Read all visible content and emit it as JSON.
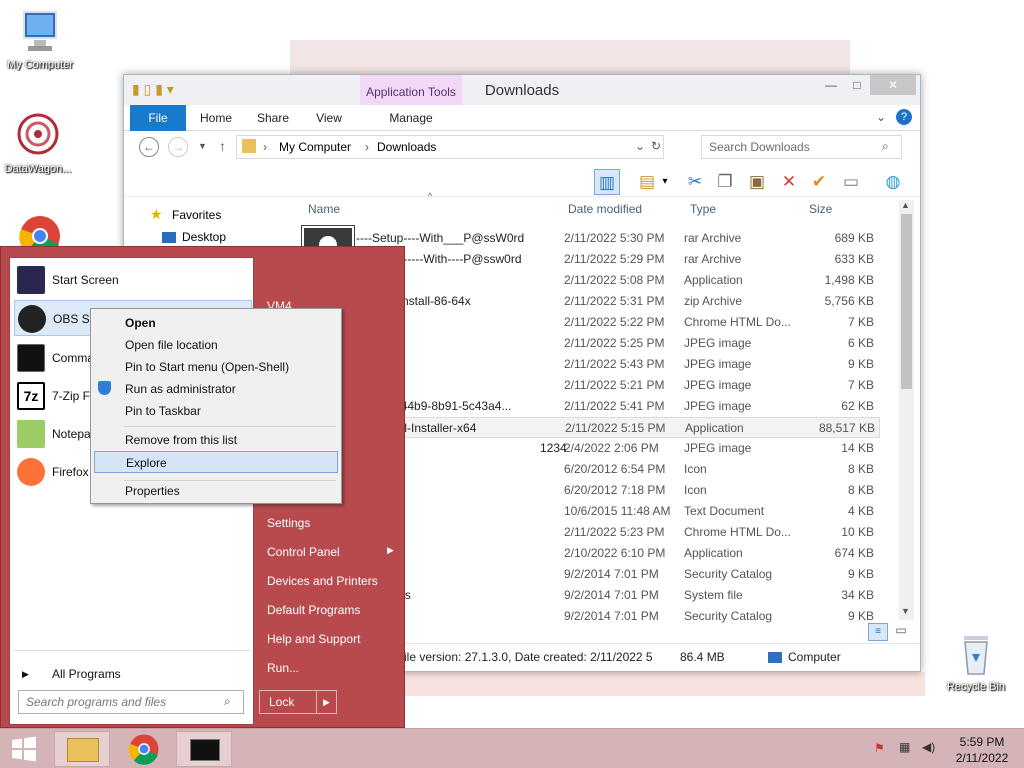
{
  "desktop": {
    "icons": [
      "My Computer",
      "DataWagon...",
      "Recycle Bin"
    ]
  },
  "explorer": {
    "title": "Downloads",
    "application_tools": "Application Tools",
    "ribbon_tabs": [
      "File",
      "Home",
      "Share",
      "View",
      "Manage"
    ],
    "address": {
      "path1": "My Computer",
      "path2": "Downloads"
    },
    "search_placeholder": "Search Downloads",
    "nav": {
      "favorites": "Favorites",
      "desktop": "Desktop"
    },
    "columns": {
      "name": "Name",
      "date": "Date modified",
      "type": "Type",
      "size": "Size"
    },
    "files": [
      {
        "name": "----Setup----With___P@ssW0rd",
        "date": "2/11/2022 5:30 PM",
        "type": "rar Archive",
        "size": "689 KB"
      },
      {
        "name": "----Setup-----With----P@ssw0rd",
        "date": "2/11/2022 5:29 PM",
        "type": "rar Archive",
        "size": "633 KB"
      },
      {
        "name": "",
        "date": "2/11/2022 5:08 PM",
        "type": "Application",
        "size": "1,498 KB"
      },
      {
        "name": "57-MSI-Install-86-64x",
        "date": "2/11/2022 5:31 PM",
        "type": "zip Archive",
        "size": "5,756 KB"
      },
      {
        "name": "",
        "date": "2/11/2022 5:22 PM",
        "type": "Chrome HTML Do...",
        "size": "7 KB"
      },
      {
        "name": "",
        "date": "2/11/2022 5:25 PM",
        "type": "JPEG image",
        "size": "6 KB"
      },
      {
        "name": "",
        "date": "2/11/2022 5:43 PM",
        "type": "JPEG image",
        "size": "9 KB"
      },
      {
        "name": "",
        "date": "2/11/2022 5:21 PM",
        "type": "JPEG image",
        "size": "7 KB"
      },
      {
        "name": "6f-088e-44b9-8b91-5c43a4...",
        "date": "2/11/2022 5:41 PM",
        "type": "JPEG image",
        "size": "62 KB"
      },
      {
        "name": "7.1.3-Full-Installer-x64",
        "date": "2/11/2022 5:15 PM",
        "type": "Application",
        "size": "88,517 KB"
      },
      {
        "name": "1234",
        "date": "2/4/2022 2:06 PM",
        "type": "JPEG image",
        "size": "14 KB"
      },
      {
        "name": "",
        "date": "6/20/2012 6:54 PM",
        "type": "Icon",
        "size": "8 KB"
      },
      {
        "name": "",
        "date": "6/20/2012 7:18 PM",
        "type": "Icon",
        "size": "8 KB"
      },
      {
        "name": "",
        "date": "10/6/2015 11:48 AM",
        "type": "Text Document",
        "size": "4 KB"
      },
      {
        "name": "",
        "date": "2/11/2022 5:23 PM",
        "type": "Chrome HTML Do...",
        "size": "10 KB"
      },
      {
        "name": "",
        "date": "2/10/2022 6:10 PM",
        "type": "Application",
        "size": "674 KB"
      },
      {
        "name": "_2003",
        "date": "9/2/2014 7:01 PM",
        "type": "Security Catalog",
        "size": "9 KB"
      },
      {
        "name": "_2003.sys",
        "date": "9/2/2014 7:01 PM",
        "type": "System file",
        "size": "34 KB"
      },
      {
        "name": "vista",
        "date": "9/2/2014 7:01 PM",
        "type": "Security Catalog",
        "size": "9 KB"
      }
    ],
    "status": {
      "details": ".com, File version: 27.1.3.0, Date created: 2/11/2022 5",
      "size": "86.4 MB",
      "location": "Computer"
    }
  },
  "start_menu": {
    "pinned": [
      "Start Screen",
      "OBS Stu",
      "Comma",
      "7-Zip Fi",
      "Notepa",
      "Firefox"
    ],
    "all_programs": "All Programs",
    "search_placeholder": "Search programs and files",
    "right_items": [
      "VM4",
      "Settings",
      "Control Panel",
      "Devices and Printers",
      "Default Programs",
      "Help and Support",
      "Run..."
    ],
    "lock": "Lock"
  },
  "context_menu": {
    "items": [
      "Open",
      "Open file location",
      "Pin to Start menu (Open-Shell)",
      "Run as administrator",
      "Pin to Taskbar",
      "Remove from this list",
      "Explore",
      "Properties"
    ]
  },
  "taskbar": {
    "time": "5:59 PM",
    "date": "2/11/2022"
  },
  "colors": {
    "accent": "#1979ca",
    "start_menu": "#b84a4e",
    "taskbar": "#d5b4b7",
    "selection": "#d5e5f7"
  }
}
